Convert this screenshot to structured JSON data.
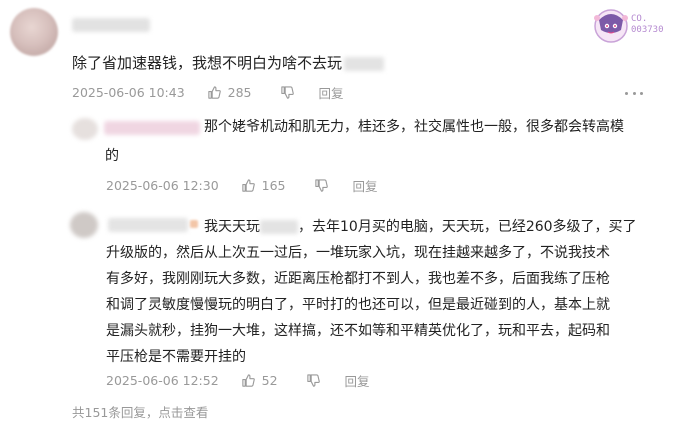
{
  "comment": {
    "text": "除了省加速器钱，我想不明白为啥不去玩",
    "time": "2025-06-06 10:43",
    "likes": "285",
    "reply_label": "回复"
  },
  "badge": {
    "label_top": "CO.",
    "label_bottom": "003730"
  },
  "replies": [
    {
      "text_line1": "那个姥爷机动和肌无力，桂还多，社交属性也一般，很多都会转高模",
      "text_line2": "的",
      "time": "2025-06-06 12:30",
      "likes": "165",
      "reply_label": "回复"
    },
    {
      "line1_a": "我天天玩",
      "line1_b": "，去年10月买的电脑，天天玩，已经260多级了，买了",
      "lines": [
        "升级版的，然后从上次五一过后，一堆玩家入坑，现在挂越来越多了，不说我技术",
        "有多好，我刚刚玩大多数，近距离压枪都打不到人，我也差不多，后面我练了压枪",
        "和调了灵敏度慢慢玩的明白了，平时打的也还可以，但是最近碰到的人，基本上就",
        "是漏头就秒，挂狗一大堆，这样搞，还不如等和平精英优化了，玩和平去，起码和",
        "平压枪是不需要开挂的"
      ],
      "time": "2025-06-06 12:52",
      "likes": "52",
      "reply_label": "回复"
    }
  ],
  "footer": {
    "text": "共151条回复，点击查看"
  }
}
